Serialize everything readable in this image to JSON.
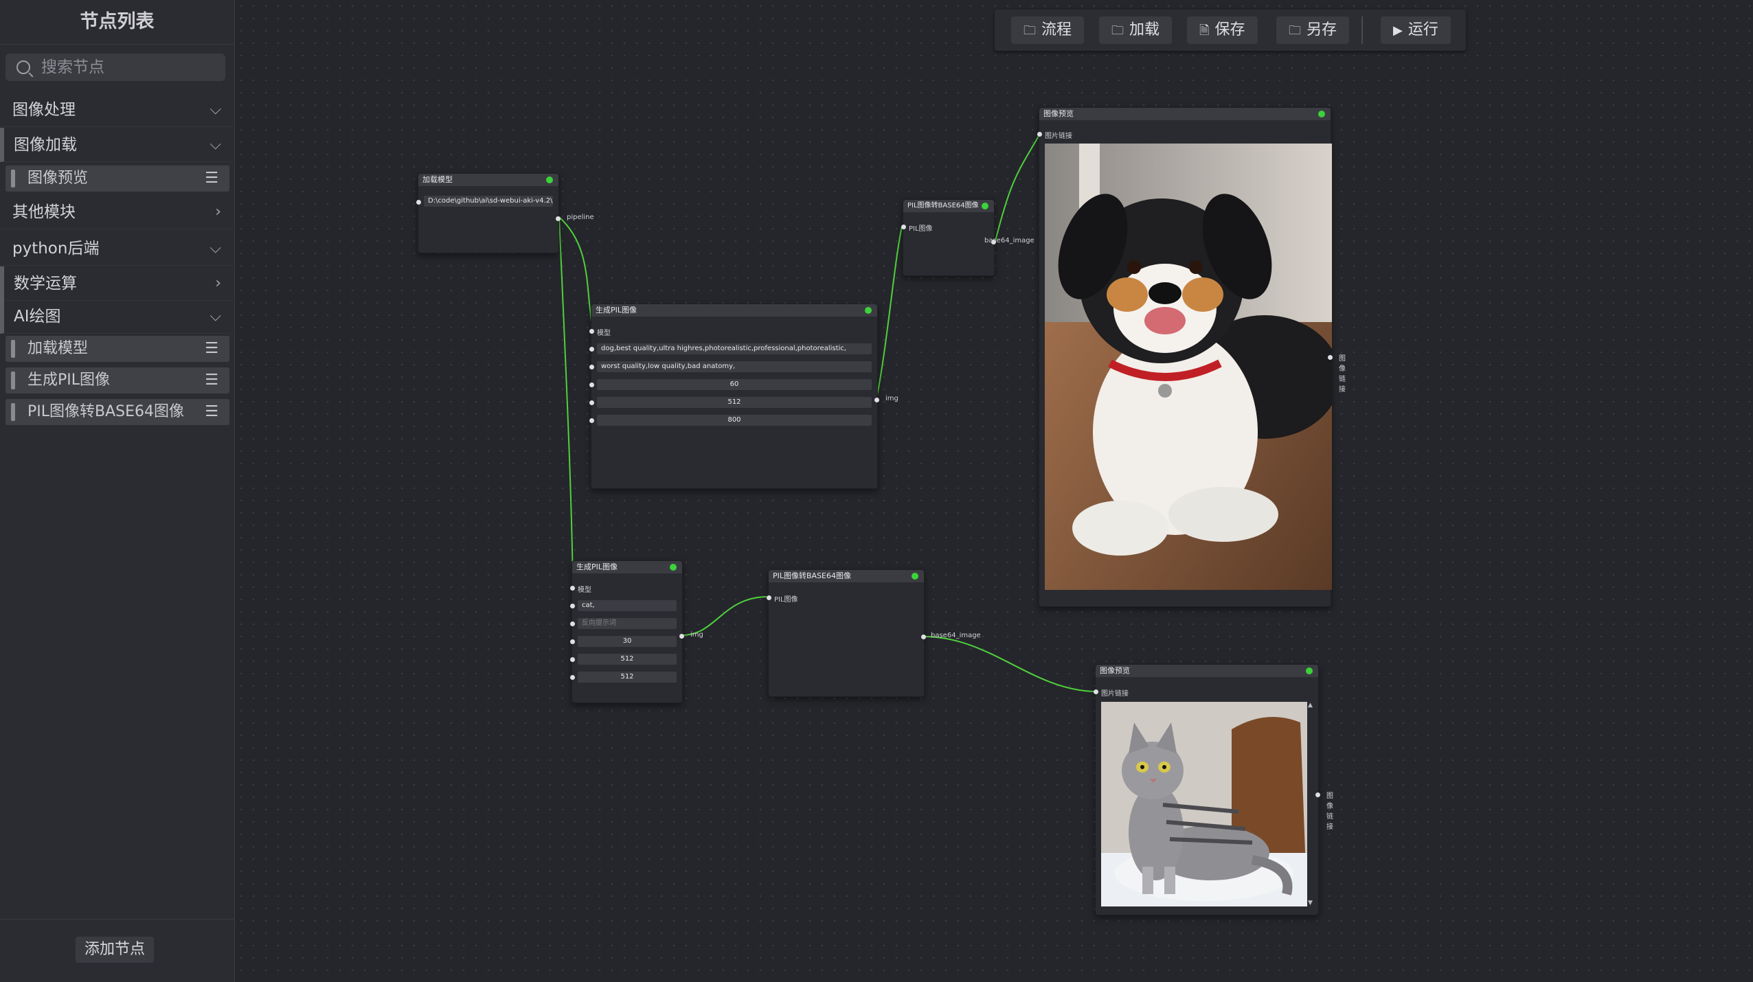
{
  "sidebar": {
    "title": "节点列表",
    "search_placeholder": "搜索节点",
    "categories": [
      {
        "label": "图像处理",
        "state": "expanded"
      },
      {
        "label": "图像加载",
        "state": "expanded"
      },
      {
        "label": "其他模块",
        "state": "collapsed"
      },
      {
        "label": "python后端",
        "state": "expanded"
      },
      {
        "label": "数学运算",
        "state": "collapsed"
      },
      {
        "label": "AI绘图",
        "state": "expanded"
      }
    ],
    "items": [
      {
        "label": "图像预览"
      },
      {
        "label": "加载模型"
      },
      {
        "label": "生成PIL图像"
      },
      {
        "label": "PIL图像转BASE64图像"
      }
    ],
    "add_button": "添加节点"
  },
  "toolbar": {
    "flow": "流程",
    "load": "加载",
    "save": "保存",
    "save_as": "另存",
    "run": "运行"
  },
  "nodes": {
    "load_model": {
      "title": "加载模型",
      "path": "D:\\code\\github\\ai\\sd-webui-aki-v4.2\\n",
      "out": "pipeline"
    },
    "gen1": {
      "title": "生成PIL图像",
      "in_model": "模型",
      "prompt": "dog,best quality,ultra highres,photorealistic,professional,photorealistic,",
      "neg": "worst quality,low quality,bad anatomy,",
      "steps": "60",
      "width": "512",
      "height": "800",
      "out": "img"
    },
    "b64_1": {
      "title": "PIL图像转BASE64图像",
      "in": "PIL图像",
      "out": "base64_image"
    },
    "preview1": {
      "title": "图像预览",
      "in": "图片链接",
      "out": "图像链接"
    },
    "gen2": {
      "title": "生成PIL图像",
      "in_model": "模型",
      "prompt": "cat,",
      "neg_placeholder": "反向提示词",
      "steps": "30",
      "width": "512",
      "height": "512",
      "out": "img"
    },
    "b64_2": {
      "title": "PIL图像转BASE64图像",
      "in": "PIL图像",
      "out": "base64_image"
    },
    "preview2": {
      "title": "图像预览",
      "in": "图片链接",
      "out": "图像链接"
    }
  },
  "colors": {
    "wire": "#4fd13d",
    "status": "#3bd23b",
    "canvas": "#25262b",
    "sidebar": "#2b2c31"
  }
}
